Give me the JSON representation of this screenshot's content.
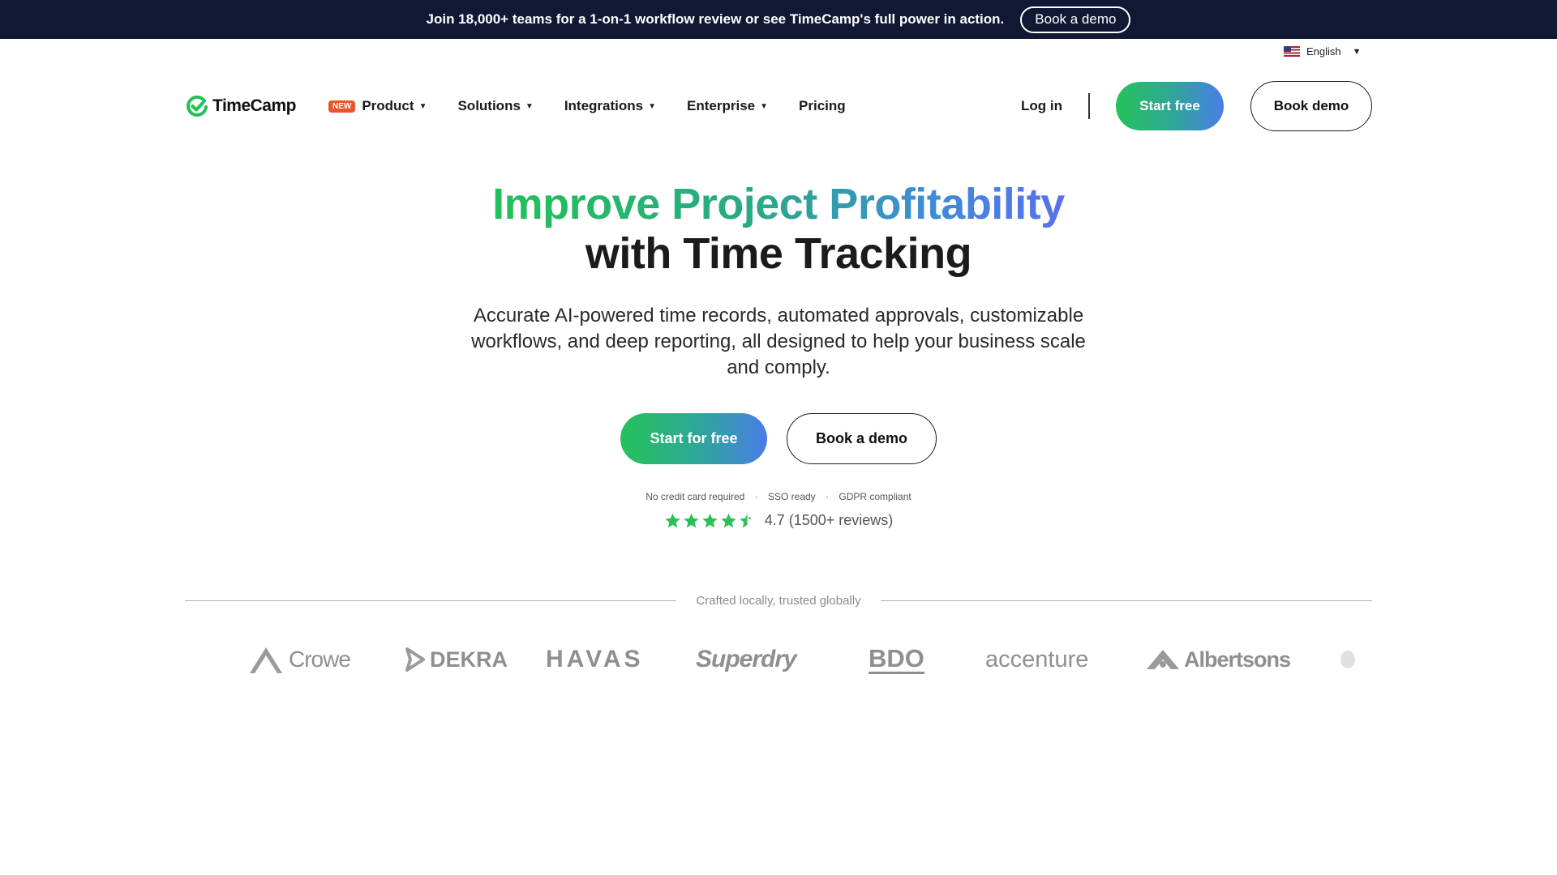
{
  "announcement": {
    "text": "Join 18,000+ teams for a 1-on-1 workflow review or see TimeCamp's full power in action.",
    "button": "Book a demo"
  },
  "language": {
    "label": "English",
    "icon": "us-flag-icon"
  },
  "nav": {
    "logo": "TimeCamp",
    "new_badge": "NEW",
    "items": [
      {
        "label": "Product",
        "has_dropdown": true
      },
      {
        "label": "Solutions",
        "has_dropdown": true
      },
      {
        "label": "Integrations",
        "has_dropdown": true
      },
      {
        "label": "Enterprise",
        "has_dropdown": true
      },
      {
        "label": "Pricing",
        "has_dropdown": false
      }
    ],
    "login": "Log in",
    "start": "Start free",
    "demo": "Book demo"
  },
  "hero": {
    "title_line1": "Improve Project Profitability",
    "title_line2": "with Time Tracking",
    "subtitle": "Accurate AI-powered time records, automated approvals, customizable workflows, and deep reporting, all designed to help your business scale and comply.",
    "cta_primary": "Start for free",
    "cta_secondary": "Book a demo",
    "assurances": [
      "No credit card required",
      "SSO ready",
      "GDPR compliant"
    ],
    "assurance_separator": "·",
    "rating": {
      "stars": 4.5,
      "text": "4.7 (1500+ reviews)"
    }
  },
  "trusted": {
    "label": "Crafted locally, trusted globally",
    "logos": [
      "Crowe",
      "DEKRA",
      "HAVAS",
      "Superdry",
      "BDO",
      "accenture",
      "Albertsons"
    ]
  },
  "colors": {
    "topbar_bg": "#111833",
    "accent_green": "#25c25a",
    "accent_blue": "#4a7de8",
    "badge_orange": "#e8562a",
    "star_green": "#2bc05a"
  }
}
